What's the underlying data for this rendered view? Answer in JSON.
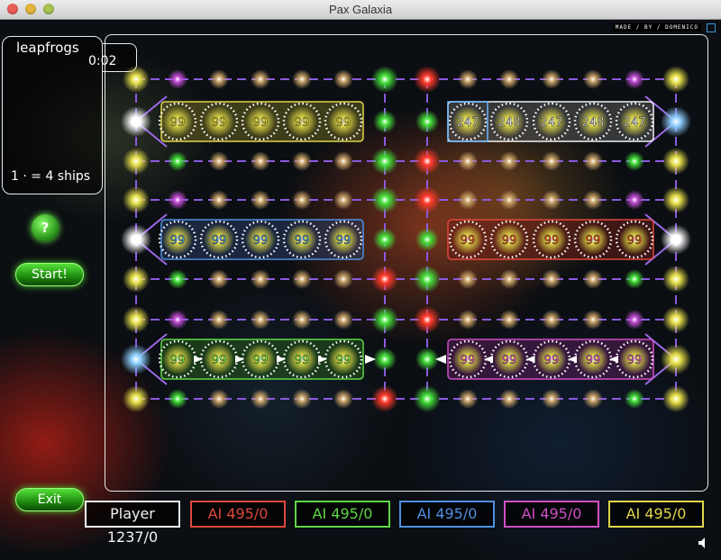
{
  "window": {
    "title": "Pax Galaxia"
  },
  "credit": "MADE / BY / DOMENICO",
  "level": {
    "name": "leapfrogs",
    "timer": "0:02",
    "ships_info": "1 · = 4 ships"
  },
  "buttons": {
    "help": "?",
    "start": "Start!",
    "exit": "Exit"
  },
  "teams": [
    {
      "id": "yellow",
      "color": "#e0d64a",
      "fill": "#6a6520",
      "text": "#f4e448",
      "ships": 99,
      "arrow": ""
    },
    {
      "id": "white",
      "color": "#f2f2f2",
      "fill": "#5a5a5a",
      "text": "#ffffff",
      "ships": 247,
      "arrow": ""
    },
    {
      "id": "blue",
      "color": "#4f8fe0",
      "fill": "#2a3d64",
      "text": "#4aa6ff",
      "ships": 99,
      "arrow": ""
    },
    {
      "id": "red",
      "color": "#e0473c",
      "fill": "#6a1e18",
      "text": "#ff4a3a",
      "ships": 99,
      "arrow": ""
    },
    {
      "id": "green",
      "color": "#5fd646",
      "fill": "#245a1a",
      "text": "#7aff5c",
      "ships": 99,
      "arrow": "right"
    },
    {
      "id": "magenta",
      "color": "#cf4fc6",
      "fill": "#5a1e58",
      "text": "#ff5cf0",
      "ships": 99,
      "arrow": "left"
    }
  ],
  "board_labels": {
    "yellow": [
      "99",
      "99",
      "99",
      "99",
      "99"
    ],
    "white": [
      "247",
      "248",
      "247",
      "248",
      "247"
    ],
    "blue": [
      "99",
      "99",
      "99",
      "99",
      "99"
    ],
    "red": [
      "99",
      "99",
      "99",
      "99",
      "99"
    ],
    "green": [
      "99",
      "99",
      "99",
      "99",
      "99"
    ],
    "magenta": [
      "99",
      "99",
      "99",
      "99",
      "99"
    ]
  },
  "scores": [
    {
      "label": "Player 1237/0",
      "color": "#f2f2f2"
    },
    {
      "label": "AI 495/0",
      "color": "#e0473c"
    },
    {
      "label": "AI 495/0",
      "color": "#5fd646"
    },
    {
      "label": "AI 495/0",
      "color": "#4f8fe0"
    },
    {
      "label": "AI 495/0",
      "color": "#cf4fc6"
    },
    {
      "label": "AI 495/0",
      "color": "#e0d64a"
    }
  ],
  "colors": {
    "lane": "#8a5ae0",
    "lane_alt": "#5a3fb0"
  }
}
